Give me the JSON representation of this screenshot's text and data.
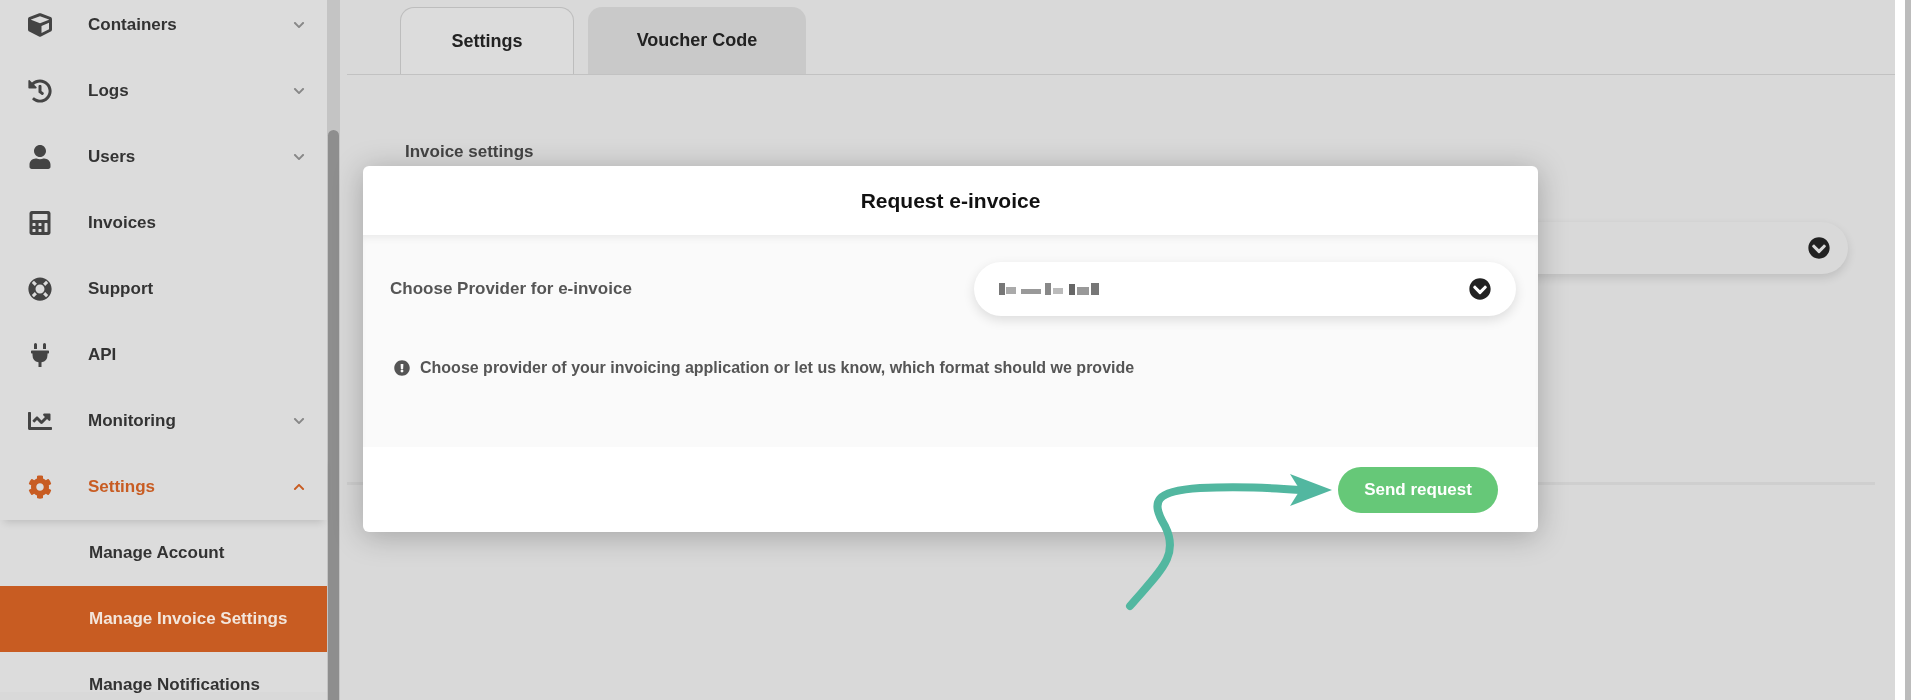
{
  "sidebar": {
    "items": [
      {
        "label": "Containers",
        "kind": "group",
        "expanded": false,
        "selected": false
      },
      {
        "label": "Logs",
        "kind": "group",
        "expanded": false,
        "selected": false
      },
      {
        "label": "Users",
        "kind": "group",
        "expanded": false,
        "selected": false
      },
      {
        "label": "Invoices",
        "kind": "link",
        "selected": false
      },
      {
        "label": "Support",
        "kind": "link",
        "selected": false
      },
      {
        "label": "API",
        "kind": "link",
        "selected": false
      },
      {
        "label": "Monitoring",
        "kind": "group",
        "expanded": false,
        "selected": false
      },
      {
        "label": "Settings",
        "kind": "group",
        "expanded": true,
        "selected": true,
        "children": [
          {
            "label": "Manage Account",
            "selected": false
          },
          {
            "label": "Manage Invoice Settings",
            "selected": true
          },
          {
            "label": "Manage Notifications",
            "selected": false
          }
        ]
      }
    ]
  },
  "tabs": [
    {
      "label": "Settings",
      "selected": true
    },
    {
      "label": "Voucher Code",
      "selected": false
    }
  ],
  "section": {
    "heading": "Invoice settings"
  },
  "modal": {
    "title": "Request e-invoice",
    "field_label": "Choose Provider for e-invoice",
    "hint": "Choose provider of your invoicing application or let us know, which format should we provide",
    "button": "Send request"
  }
}
